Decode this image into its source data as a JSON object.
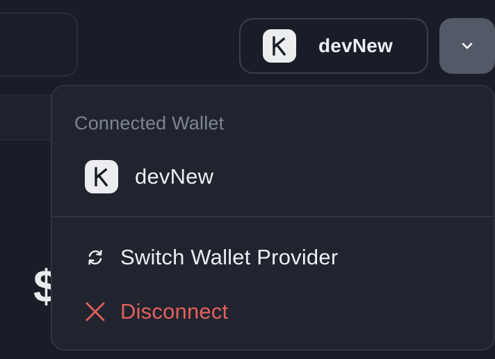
{
  "header": {
    "wallet_name": "devNew"
  },
  "background": {
    "partial_text": "$"
  },
  "dropdown": {
    "section_title": "Connected Wallet",
    "connected_wallet_name": "devNew",
    "switch_label": "Switch Wallet Provider",
    "disconnect_label": "Disconnect"
  },
  "icons": {
    "wallet_logo": "k-logo-icon",
    "chevron": "chevron-down-icon",
    "switch": "refresh-icon",
    "disconnect": "close-icon"
  },
  "colors": {
    "background": "#1a1d27",
    "panel": "#21242e",
    "border": "#30343f",
    "chevron_button": "#535966",
    "muted_text": "#7d8593",
    "danger": "#e2605c",
    "logo_bg": "#ecedef"
  }
}
